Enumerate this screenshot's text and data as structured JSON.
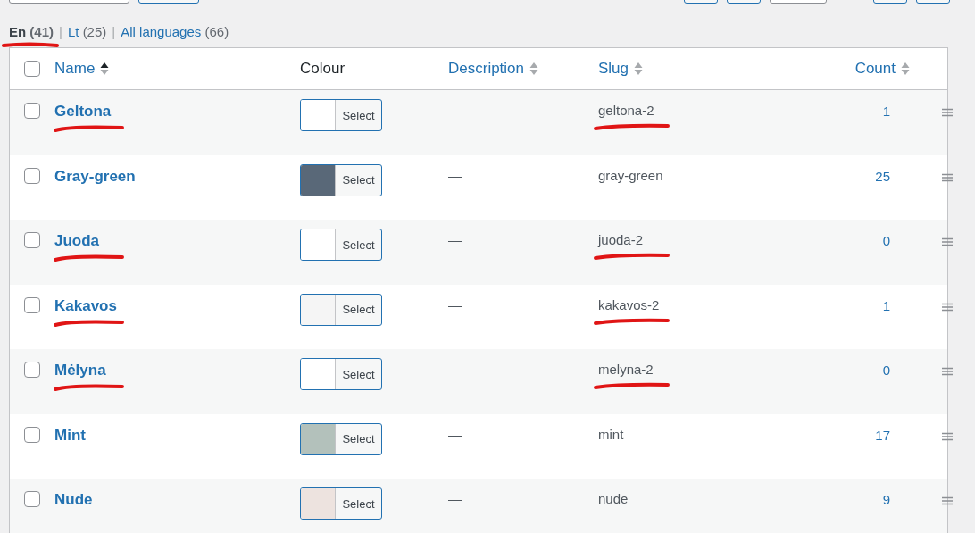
{
  "language_filters": [
    {
      "label": "En",
      "count": "(41)",
      "selected": true,
      "marked": true,
      "separator": "|"
    },
    {
      "label": "Lt",
      "count": "(25)",
      "selected": false,
      "marked": false,
      "separator": "|"
    },
    {
      "label": "All languages",
      "count": "(66)",
      "selected": false,
      "marked": false
    }
  ],
  "table": {
    "all_checked": false,
    "columns": [
      {
        "kind": "name",
        "label": "Name",
        "sortable": true,
        "sorted": true
      },
      {
        "kind": "colour",
        "label": "Colour",
        "sortable": false
      },
      {
        "kind": "description",
        "label": "Description",
        "sortable": true,
        "sorted": false
      },
      {
        "kind": "slug",
        "label": "Slug",
        "sortable": true,
        "sorted": false
      },
      {
        "kind": "count",
        "label": "Count",
        "sortable": true,
        "sorted": false
      }
    ],
    "rows": [
      {
        "name": "Geltona",
        "color": "#ffffff",
        "button": "Select",
        "description": "—",
        "slug": "geltona-2",
        "count": "1",
        "checked": false,
        "name_marked": true,
        "slug_marked": true
      },
      {
        "name": "Gray-green",
        "color": "#596878",
        "button": "Select",
        "description": "—",
        "slug": "gray-green",
        "count": "25",
        "checked": false,
        "name_marked": false,
        "slug_marked": false
      },
      {
        "name": "Juoda",
        "color": "#ffffff",
        "button": "Select",
        "description": "—",
        "slug": "juoda-2",
        "count": "0",
        "checked": false,
        "name_marked": true,
        "slug_marked": true
      },
      {
        "name": "Kakavos",
        "color": "#f5f5f5",
        "button": "Select",
        "description": "—",
        "slug": "kakavos-2",
        "count": "1",
        "checked": false,
        "name_marked": true,
        "slug_marked": true
      },
      {
        "name": "Mėlyna",
        "color": "#ffffff",
        "button": "Select",
        "description": "—",
        "slug": "melyna-2",
        "count": "0",
        "checked": false,
        "name_marked": true,
        "slug_marked": true
      },
      {
        "name": "Mint",
        "color": "#b3c1bb",
        "button": "Select",
        "description": "—",
        "slug": "mint",
        "count": "17",
        "checked": false,
        "name_marked": false,
        "slug_marked": false
      },
      {
        "name": "Nude",
        "color": "#ede3df",
        "button": "Select",
        "description": "—",
        "slug": "nude",
        "count": "9",
        "checked": false,
        "name_marked": false,
        "slug_marked": false
      }
    ]
  }
}
